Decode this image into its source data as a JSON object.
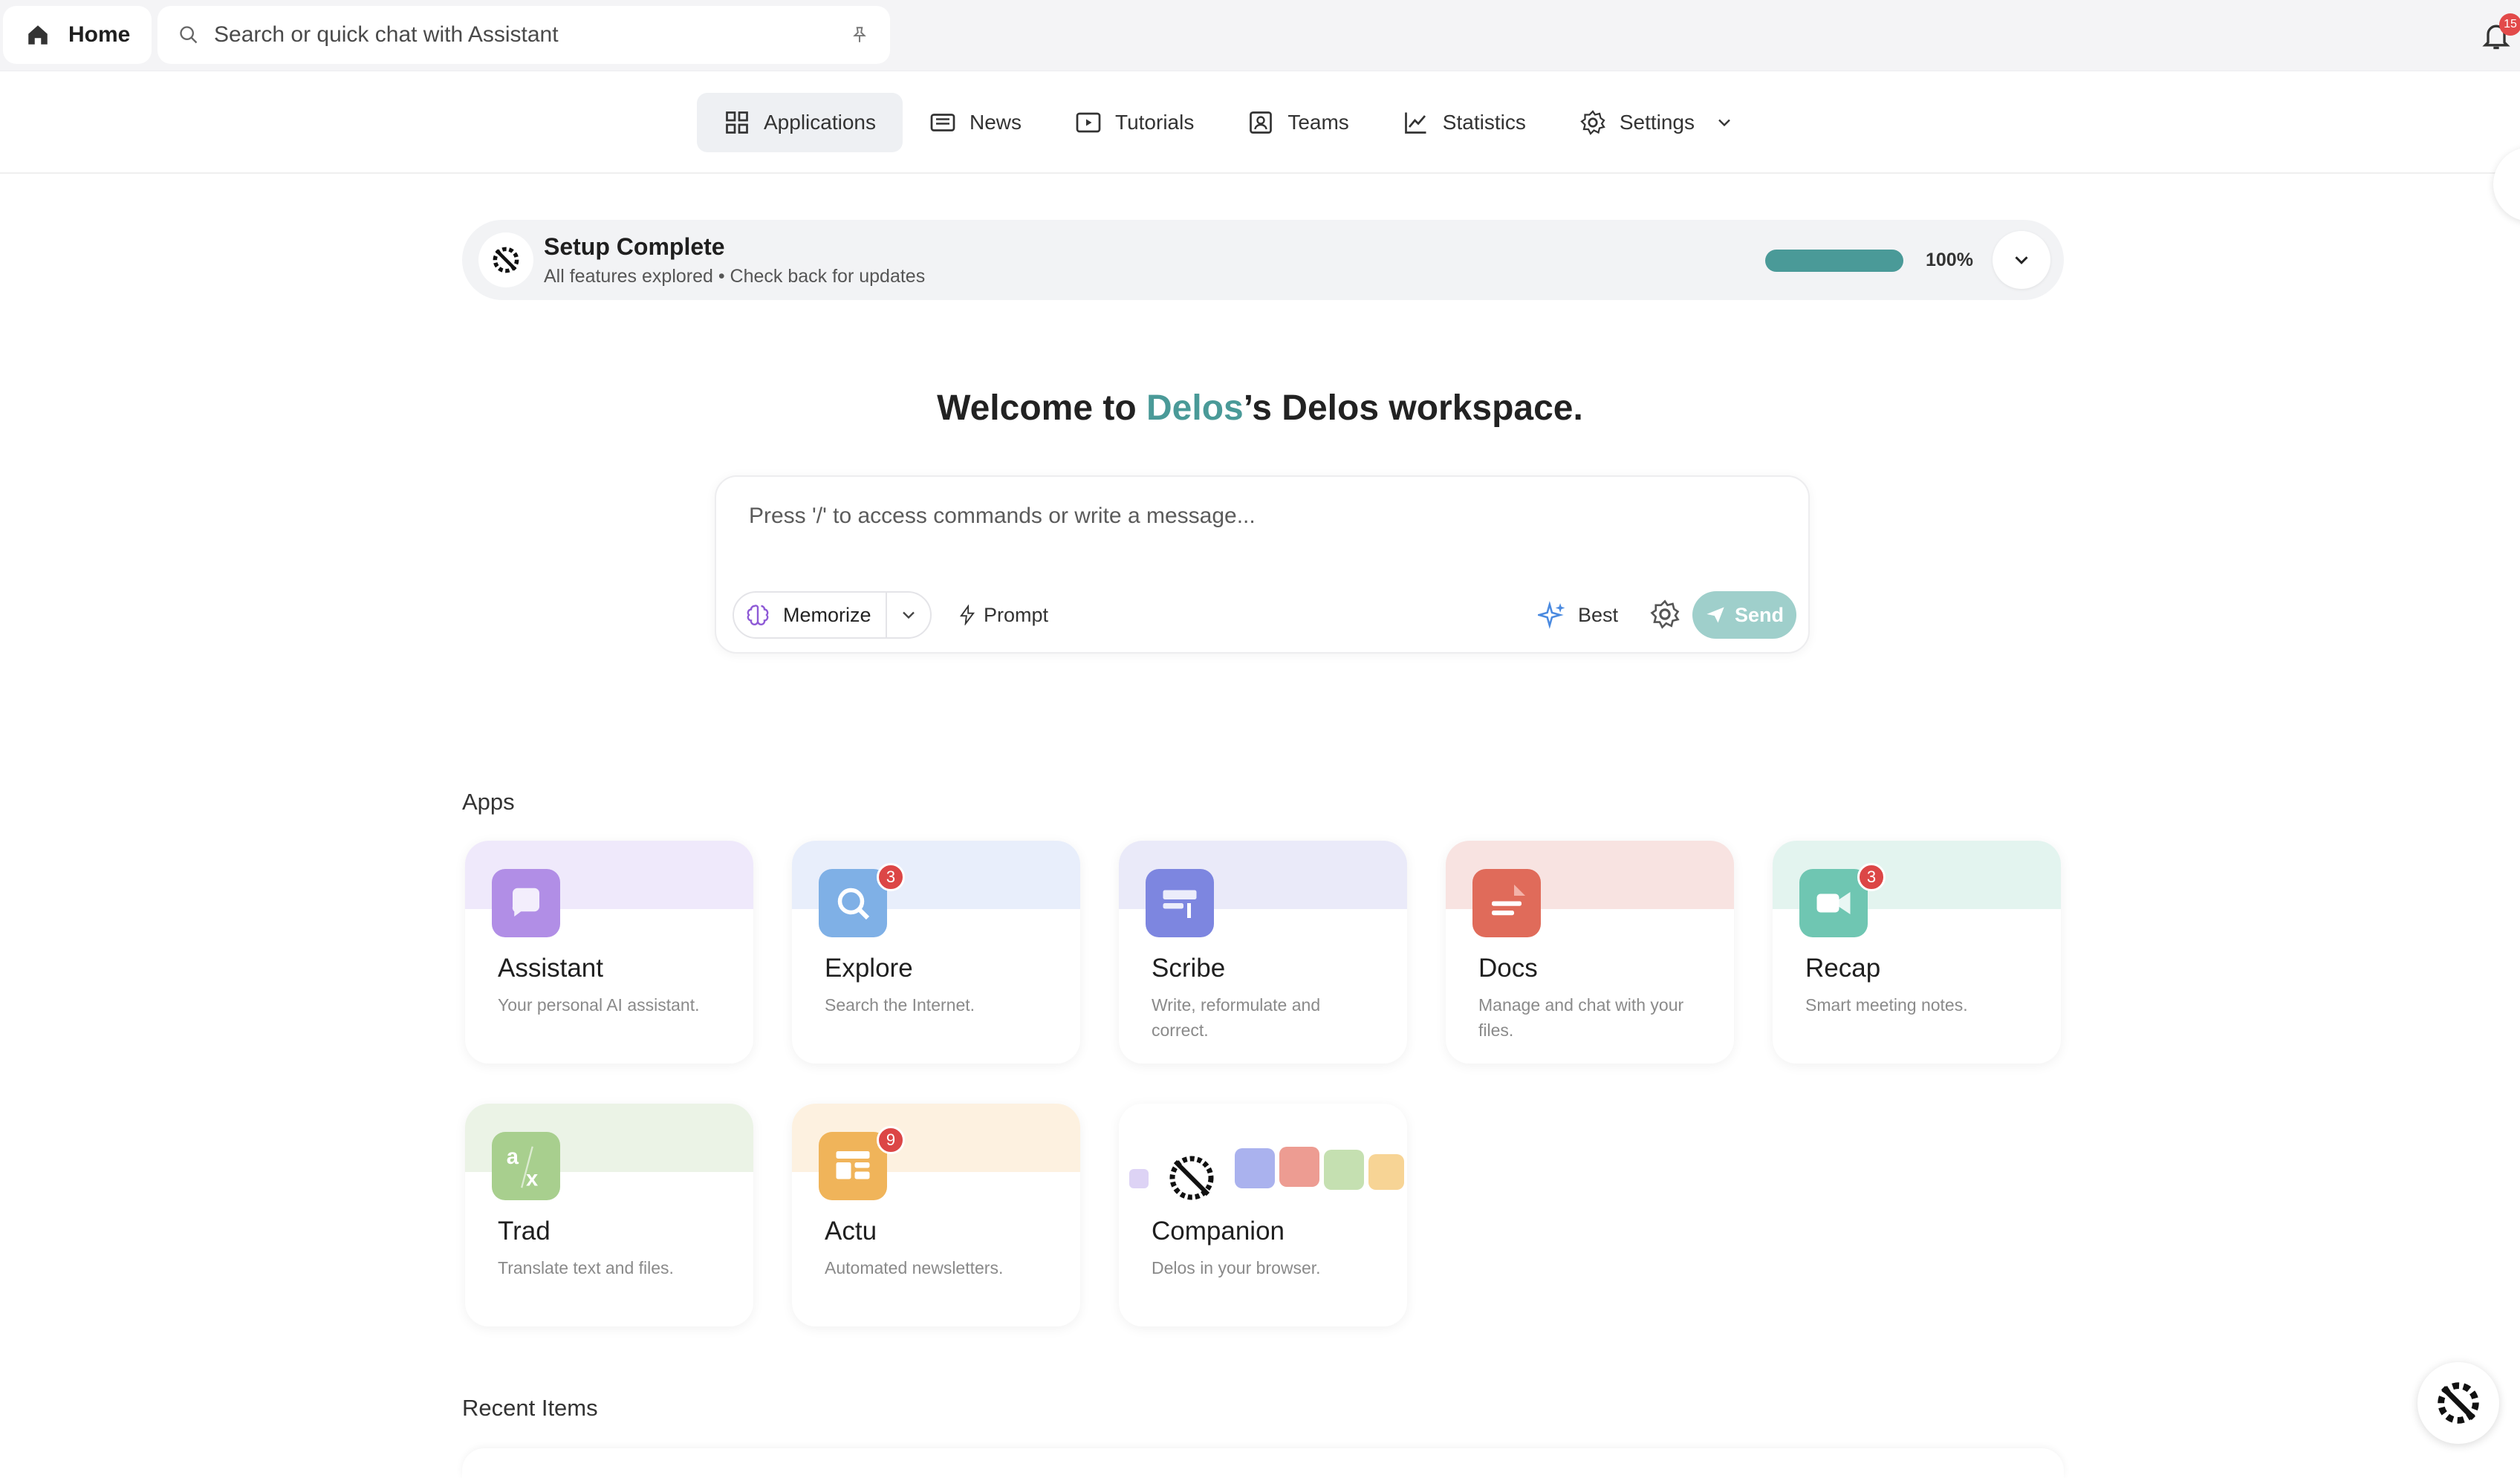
{
  "topbar": {
    "home_label": "Home",
    "search_placeholder": "Search or quick chat with Assistant",
    "notification_count": "15"
  },
  "nav": {
    "items": [
      {
        "label": "Applications",
        "icon": "grid-icon",
        "active": true
      },
      {
        "label": "News",
        "icon": "newspaper-icon"
      },
      {
        "label": "Tutorials",
        "icon": "video-icon"
      },
      {
        "label": "Teams",
        "icon": "team-icon"
      },
      {
        "label": "Statistics",
        "icon": "chart-icon"
      },
      {
        "label": "Settings",
        "icon": "gear-icon"
      }
    ]
  },
  "setup": {
    "title": "Setup Complete",
    "subtitle": "All features explored • Check back for updates",
    "progress": 1.0,
    "progress_label": "100%"
  },
  "welcome": {
    "prefix": "Welcome to ",
    "highlight": "Delos",
    "suffix": "’s Delos workspace."
  },
  "composer": {
    "placeholder": "Press '/' to access commands or write a message...",
    "memorize_label": "Memorize",
    "prompt_label": "Prompt",
    "model_label": "Best",
    "send_label": "Send"
  },
  "apps": {
    "title": "Apps",
    "items": [
      {
        "name": "Assistant",
        "desc": "Your personal AI assistant.",
        "color": "#b18ee6",
        "band": "#efe9fb",
        "badge": ""
      },
      {
        "name": "Explore",
        "desc": "Search the Internet.",
        "color": "#7fb0e6",
        "band": "#e8eefb",
        "badge": "3"
      },
      {
        "name": "Scribe",
        "desc": "Write, reformulate and correct.",
        "color": "#7d86e0",
        "band": "#eaeaf9",
        "badge": ""
      },
      {
        "name": "Docs",
        "desc": "Manage and chat with your files.",
        "color": "#e06b5a",
        "band": "#f8e3e1",
        "badge": ""
      },
      {
        "name": "Recap",
        "desc": "Smart meeting notes.",
        "color": "#6fc6b2",
        "band": "#e3f4ef",
        "badge": "3"
      },
      {
        "name": "Trad",
        "desc": "Translate text and files.",
        "color": "#a8cf8e",
        "band": "#ebf3e6",
        "badge": ""
      },
      {
        "name": "Actu",
        "desc": "Automated newsletters.",
        "color": "#f0b45a",
        "band": "#fdf1e0",
        "badge": "9"
      },
      {
        "name": "Companion",
        "desc": "Delos in your browser.",
        "color": "#000000",
        "band": "#ffffff",
        "badge": ""
      }
    ]
  },
  "recent": {
    "title": "Recent Items"
  }
}
